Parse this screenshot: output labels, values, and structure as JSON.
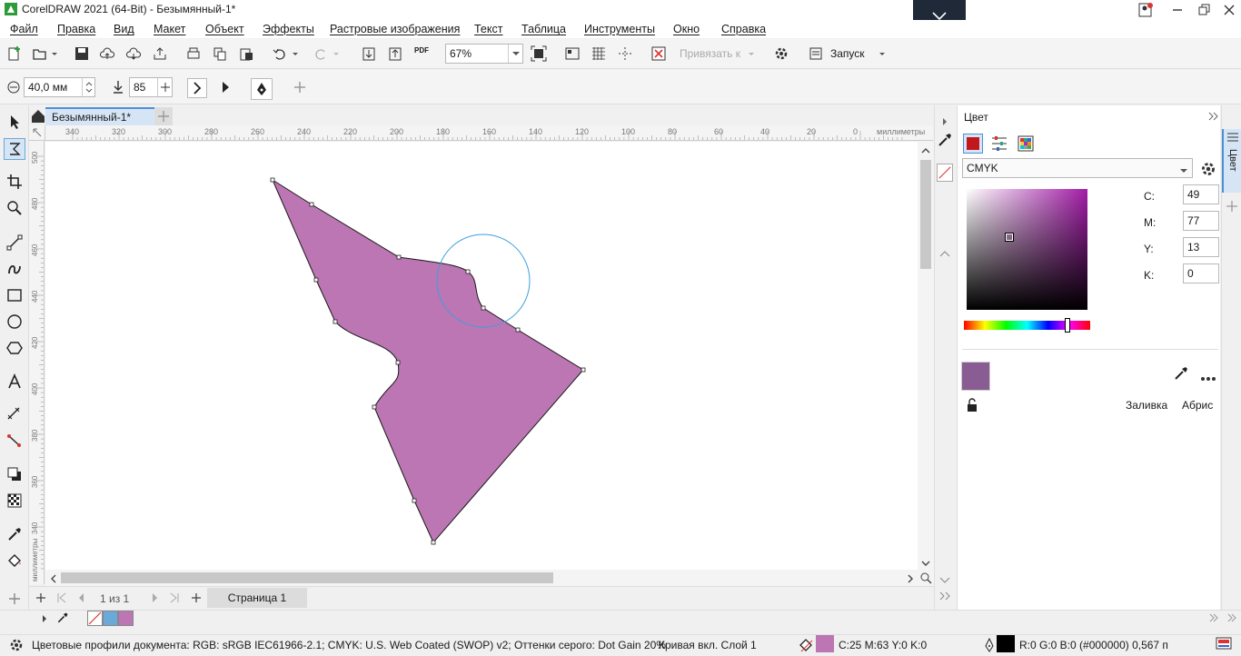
{
  "window": {
    "title": "CorelDRAW 2021 (64-Bit) - Безымянный-1*"
  },
  "menu": [
    "Файл",
    "Правка",
    "Вид",
    "Макет",
    "Объект",
    "Эффекты",
    "Растровые изображения",
    "Текст",
    "Таблица",
    "Инструменты",
    "Окно",
    "Справка"
  ],
  "toolbar": {
    "zoom": "67%",
    "snap_label": "Привязать к",
    "launch_label": "Запуск",
    "pdf_label": "PDF"
  },
  "property_bar": {
    "nib_size": "40,0 мм",
    "smoothing": "85"
  },
  "document": {
    "tab_name": "Безымянный-1*",
    "page_tab": "Страница 1",
    "page_of": "1 из 1"
  },
  "rulers": {
    "unit": "миллиметры",
    "h_ticks": [
      "340",
      "320",
      "300",
      "280",
      "260",
      "240",
      "220",
      "200",
      "180",
      "160",
      "140",
      "120",
      "100",
      "80",
      "60",
      "40",
      "20",
      "0"
    ],
    "v_ticks": [
      "500",
      "480",
      "460",
      "440",
      "420",
      "400",
      "380",
      "360",
      "340"
    ]
  },
  "shape": {
    "fill_color": "#bc76b3",
    "stroke_color": "#1a1a1a",
    "circle_color": "#3aa0dc"
  },
  "color_panel": {
    "title": "Цвет",
    "model": "CMYK",
    "c_label": "C:",
    "c_value": "49",
    "m_label": "M:",
    "m_value": "77",
    "y_label": "Y:",
    "y_value": "13",
    "k_label": "K:",
    "k_value": "0",
    "fill_label": "Заливка",
    "outline_label": "Абрис",
    "preview_color": "#8a5c94",
    "side_tab": "Цвет"
  },
  "palette": {
    "swatches": [
      "none",
      "#6aa9d8",
      "#bc76b3"
    ]
  },
  "status": {
    "profiles": "Цветовые профили документа: RGB: sRGB IEC61966-2.1; CMYK: U.S. Web Coated (SWOP) v2; Оттенки серого: Dot Gain 20%",
    "object_info": "Кривая вкл. Слой 1",
    "fill_info": "C:25 M:63 Y:0 K:0",
    "fill_color": "#bc76b3",
    "outline_info": "R:0 G:0 B:0 (#000000)  0,567 п"
  }
}
